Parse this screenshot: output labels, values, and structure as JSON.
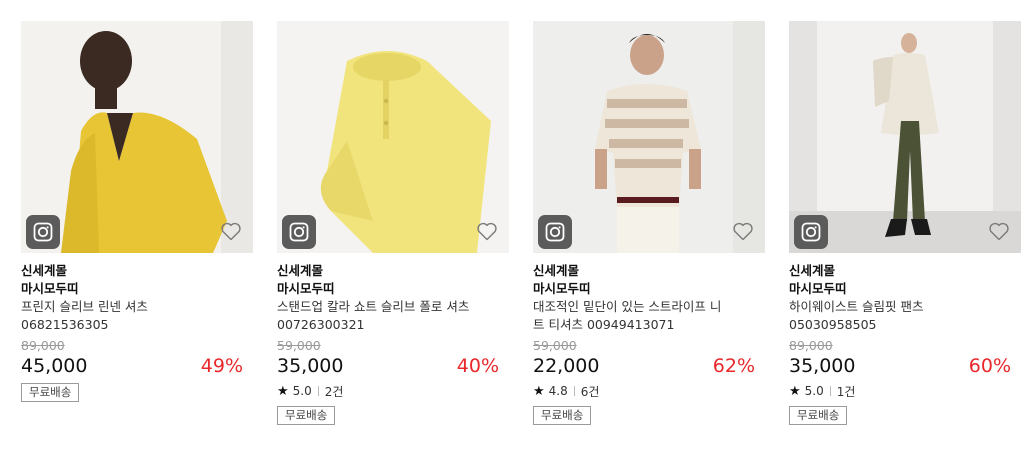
{
  "products": [
    {
      "store": "신세계몰",
      "brand": "마시모두띠",
      "name": "프린지 슬리브 린넨 셔츠 06821536305",
      "original_price": "89,000",
      "price": "45,000",
      "discount": "49%",
      "rating": "",
      "review_count": "",
      "shipping_badge": "무료배송"
    },
    {
      "store": "신세계몰",
      "brand": "마시모두띠",
      "name": "스탠드업 칼라 쇼트 슬리브 폴로 셔츠 00726300321",
      "original_price": "59,000",
      "price": "35,000",
      "discount": "40%",
      "rating": "5.0",
      "review_count": "2건",
      "shipping_badge": "무료배송"
    },
    {
      "store": "신세계몰",
      "brand": "마시모두띠",
      "name": "대조적인 밑단이 있는 스트라이프 니트 티셔츠 00949413071",
      "original_price": "59,000",
      "price": "22,000",
      "discount": "62%",
      "rating": "4.8",
      "review_count": "6건",
      "shipping_badge": "무료배송"
    },
    {
      "store": "신세계몰",
      "brand": "마시모두띠",
      "name": "하이웨이스트 슬림핏 팬츠 05030958505",
      "original_price": "89,000",
      "price": "35,000",
      "discount": "60%",
      "rating": "5.0",
      "review_count": "1건",
      "shipping_badge": "무료배송"
    }
  ],
  "icons": {
    "brand_badge": "ssg-store-icon",
    "wishlist": "heart-icon",
    "rating": "star-icon"
  },
  "colors": {
    "discount": "#e8282b",
    "original_price": "#9a9a9a",
    "badge_bg": "#5b5b5b"
  }
}
